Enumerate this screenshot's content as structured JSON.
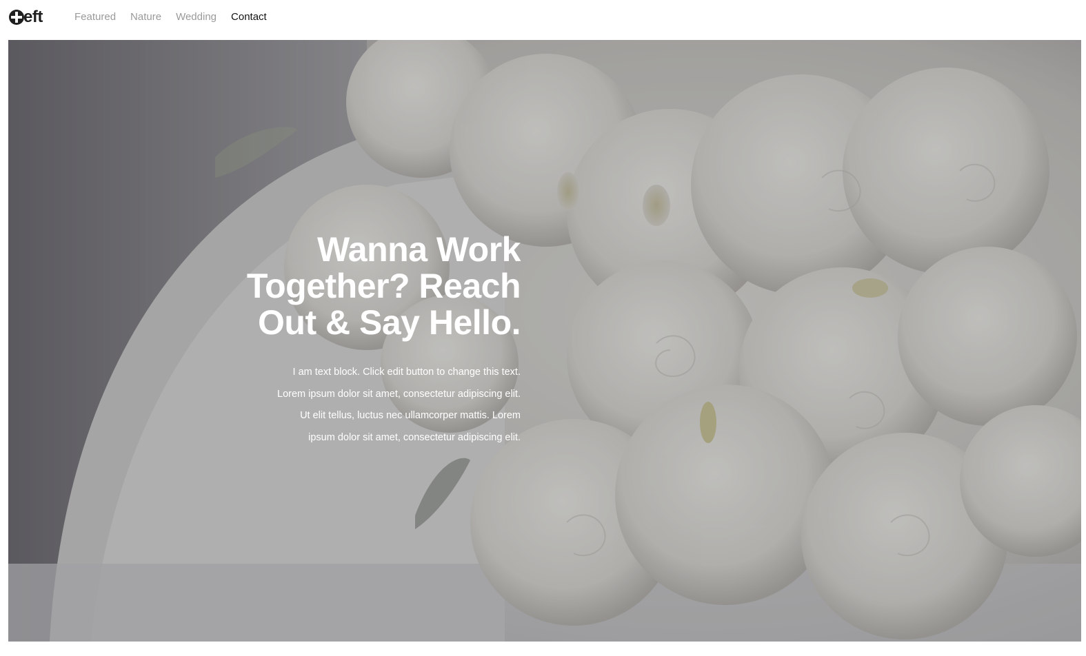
{
  "header": {
    "logo_text": "eft",
    "nav": [
      {
        "label": "Featured",
        "active": false
      },
      {
        "label": "Nature",
        "active": false
      },
      {
        "label": "Wedding",
        "active": false
      },
      {
        "label": "Contact",
        "active": true
      }
    ]
  },
  "hero": {
    "title_lines": [
      "Wanna Work",
      "Together? Reach",
      "Out & Say Hello."
    ],
    "body_lines": [
      "I am text block. Click edit button to change this text.",
      "Lorem ipsum dolor sit amet, consectetur adipiscing elit.",
      "Ut elit tellus, luctus nec ullamcorper mattis. Lorem",
      "ipsum dolor sit amet, consectetur adipiscing elit."
    ],
    "background_image": "white-roses-bouquet",
    "overlay_color": "#28282c"
  },
  "colors": {
    "nav_inactive": "#9a9a9a",
    "nav_active": "#111111",
    "hero_text": "#ffffff"
  }
}
